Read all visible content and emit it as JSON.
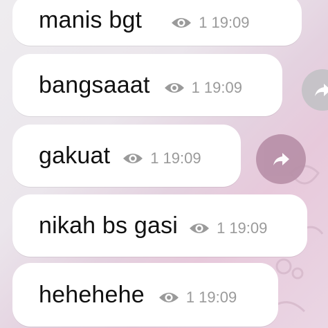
{
  "colors": {
    "bubble": "#ffffff",
    "text": "#111111",
    "meta": "#9a9a9a",
    "share_button": "#b890a8"
  },
  "messages": [
    {
      "text": "manis bgt",
      "views": "1",
      "time": "19:09"
    },
    {
      "text": "bangsaaat",
      "views": "1",
      "time": "19:09"
    },
    {
      "text": "gakuat",
      "views": "1",
      "time": "19:09"
    },
    {
      "text": "nikah bs gasi",
      "views": "1",
      "time": "19:09"
    },
    {
      "text": "hehehehe",
      "views": "1",
      "time": "19:09"
    }
  ],
  "icons": {
    "views": "eye-icon",
    "share": "share-arrow-icon"
  }
}
